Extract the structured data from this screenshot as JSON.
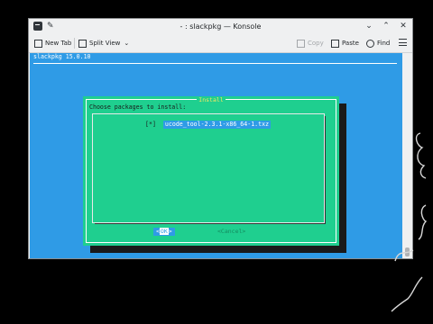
{
  "window": {
    "title": "- : slackpkg — Konsole"
  },
  "toolbar": {
    "new_tab": "New Tab",
    "split_view": "Split View",
    "copy": "Copy",
    "paste": "Paste",
    "find": "Find"
  },
  "terminal": {
    "header": "slackpkg 15.0.10"
  },
  "dialog": {
    "title": "Install",
    "prompt": "Choose packages to install:",
    "packages": [
      {
        "checked": "[*]",
        "name": "ucode_tool-2.3.1-x86_64-1.txz"
      }
    ],
    "ok_label": "OK",
    "cancel_label": "Cancel"
  },
  "colors": {
    "terminal_bg": "#2f9be6",
    "dialog_bg": "#1fcf8f",
    "title_yellow": "#f5e663"
  }
}
